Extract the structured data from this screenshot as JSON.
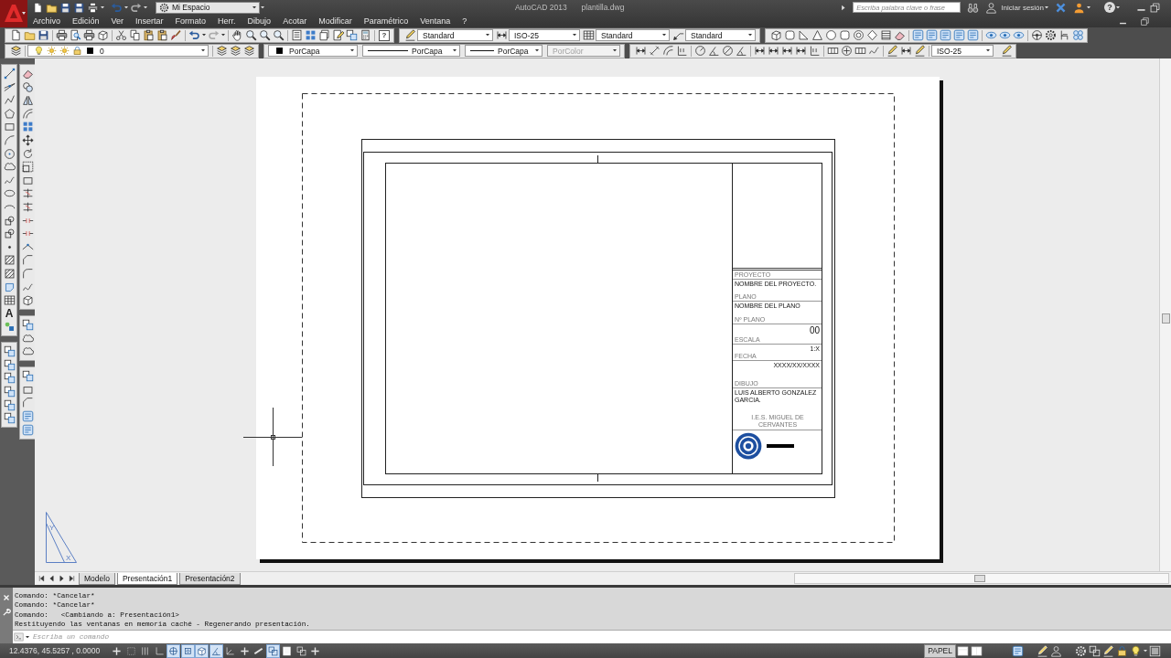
{
  "title_bar": {
    "workspace": "Mi Espacio",
    "app_name": "AutoCAD 2013",
    "file_name": "plantilla.dwg",
    "search": {
      "placeholder": "Escriba palabra clave o frase"
    },
    "sign_in": "Iniciar sesión",
    "help_glyph": "?"
  },
  "menu": [
    {
      "label": "Archivo"
    },
    {
      "label": "Edición"
    },
    {
      "label": "Ver"
    },
    {
      "label": "Insertar"
    },
    {
      "label": "Formato"
    },
    {
      "label": "Herr."
    },
    {
      "label": "Dibujo"
    },
    {
      "label": "Acotar"
    },
    {
      "label": "Modificar"
    },
    {
      "label": "Paramétrico"
    },
    {
      "label": "Ventana"
    },
    {
      "label": "?"
    }
  ],
  "styles_toolbar": {
    "help_glyph": "?",
    "text_style": "Standard",
    "dim_style": "ISO-25",
    "table_style": "Standard",
    "multileader_style": "Standard"
  },
  "properties_toolbar": {
    "layer": "0",
    "object_color": "PorCapa",
    "linetype": "PorCapa",
    "lineweight": "PorCapa",
    "plot_style": {
      "value": "PorColor",
      "disabled": true
    }
  },
  "dimension_toolbar": {
    "dim_style": "ISO-25"
  },
  "draw_toolbar": {
    "text_glyph": "A"
  },
  "paper": {
    "title_block": {
      "fields": [
        {
          "label": "PROYECTO",
          "value": "NOMBRE DEL PROYECTO.",
          "kind": "text"
        },
        {
          "label": "PLANO",
          "value": "NOMBRE DEL PLANO",
          "kind": "text"
        },
        {
          "label": "Nº PLANO",
          "value": "00",
          "kind": "number"
        },
        {
          "label": "ESCALA",
          "value": "1:X",
          "kind": "code"
        },
        {
          "label": "FECHA",
          "value": "XXXX/XX/XXXX",
          "kind": "code"
        },
        {
          "label": "DIBUJO",
          "value": "LUIS ALBERTO GONZALEZ GARCIA.",
          "kind": "text"
        }
      ],
      "school": "I.E.S. MIGUEL DE CERVANTES"
    }
  },
  "ucs_icon": {
    "x_label": "X",
    "y_label": "Y"
  },
  "layout_tabs": [
    {
      "label": "Modelo",
      "selected": false
    },
    {
      "label": "Presentación1",
      "selected": true
    },
    {
      "label": "Presentación2",
      "selected": false
    }
  ],
  "command_history": [
    "Comando: *Cancelar*",
    "Comando: *Cancelar*",
    "Comando:   <Cambiando a: Presentación1>",
    "Restituyendo las ventanas en memoria caché - Regenerando presentación."
  ],
  "command_line": {
    "placeholder": "Escriba un comando"
  },
  "status_bar": {
    "coordinates": "12.4376, 45.5257 , 0.0000",
    "toggles": [
      {
        "on": false
      },
      {
        "on": false
      },
      {
        "on": false
      },
      {
        "on": false
      },
      {
        "on": true
      },
      {
        "on": true
      },
      {
        "on": true
      },
      {
        "on": true
      },
      {
        "on": false
      },
      {
        "on": false
      },
      {
        "on": false
      },
      {
        "on": true
      },
      {
        "on": false
      },
      {
        "on": false
      },
      {
        "on": false
      }
    ],
    "space": "PAPEL"
  }
}
